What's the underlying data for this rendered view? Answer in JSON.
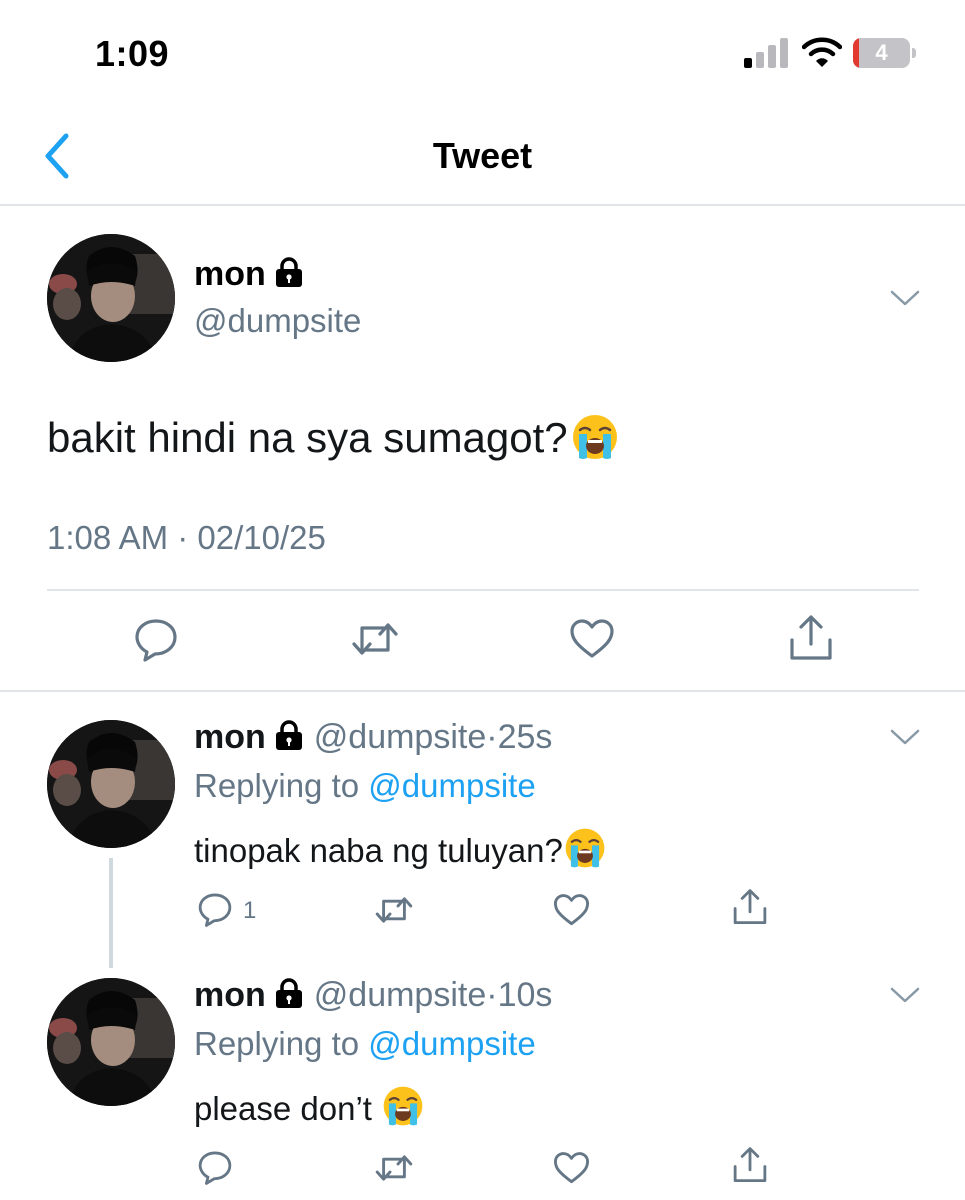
{
  "status_bar": {
    "time": "1:09",
    "battery_level": "4",
    "battery_fraction": 0.04,
    "battery_color": "#e23a2f"
  },
  "nav": {
    "back_icon": "chevron-left-icon",
    "title": "Tweet"
  },
  "colors": {
    "accent": "#1da1f2",
    "secondary_text": "#657786",
    "divider": "#e1e4e8"
  },
  "main_tweet": {
    "display_name": "mon",
    "handle": "@dumpsite",
    "text": "bakit hindi na sya sumagot?",
    "text_emoji": "loudly-crying-face",
    "timestamp": "1:08 AM · 02/10/25",
    "actions": [
      "reply-icon",
      "retweet-icon",
      "like-icon",
      "share-icon"
    ]
  },
  "replies": [
    {
      "display_name": "mon",
      "handle": "@dumpsite",
      "age": "25s",
      "replying_prefix": "Replying to",
      "replying_to": "@dumpsite",
      "text": "tinopak naba ng tuluyan?",
      "text_emoji": "loudly-crying-face",
      "reply_count": "1"
    },
    {
      "display_name": "mon",
      "handle": "@dumpsite",
      "age": "10s",
      "replying_prefix": "Replying to",
      "replying_to": "@dumpsite",
      "text": "please don’t ",
      "text_emoji": "loudly-crying-face",
      "reply_count": ""
    }
  ]
}
